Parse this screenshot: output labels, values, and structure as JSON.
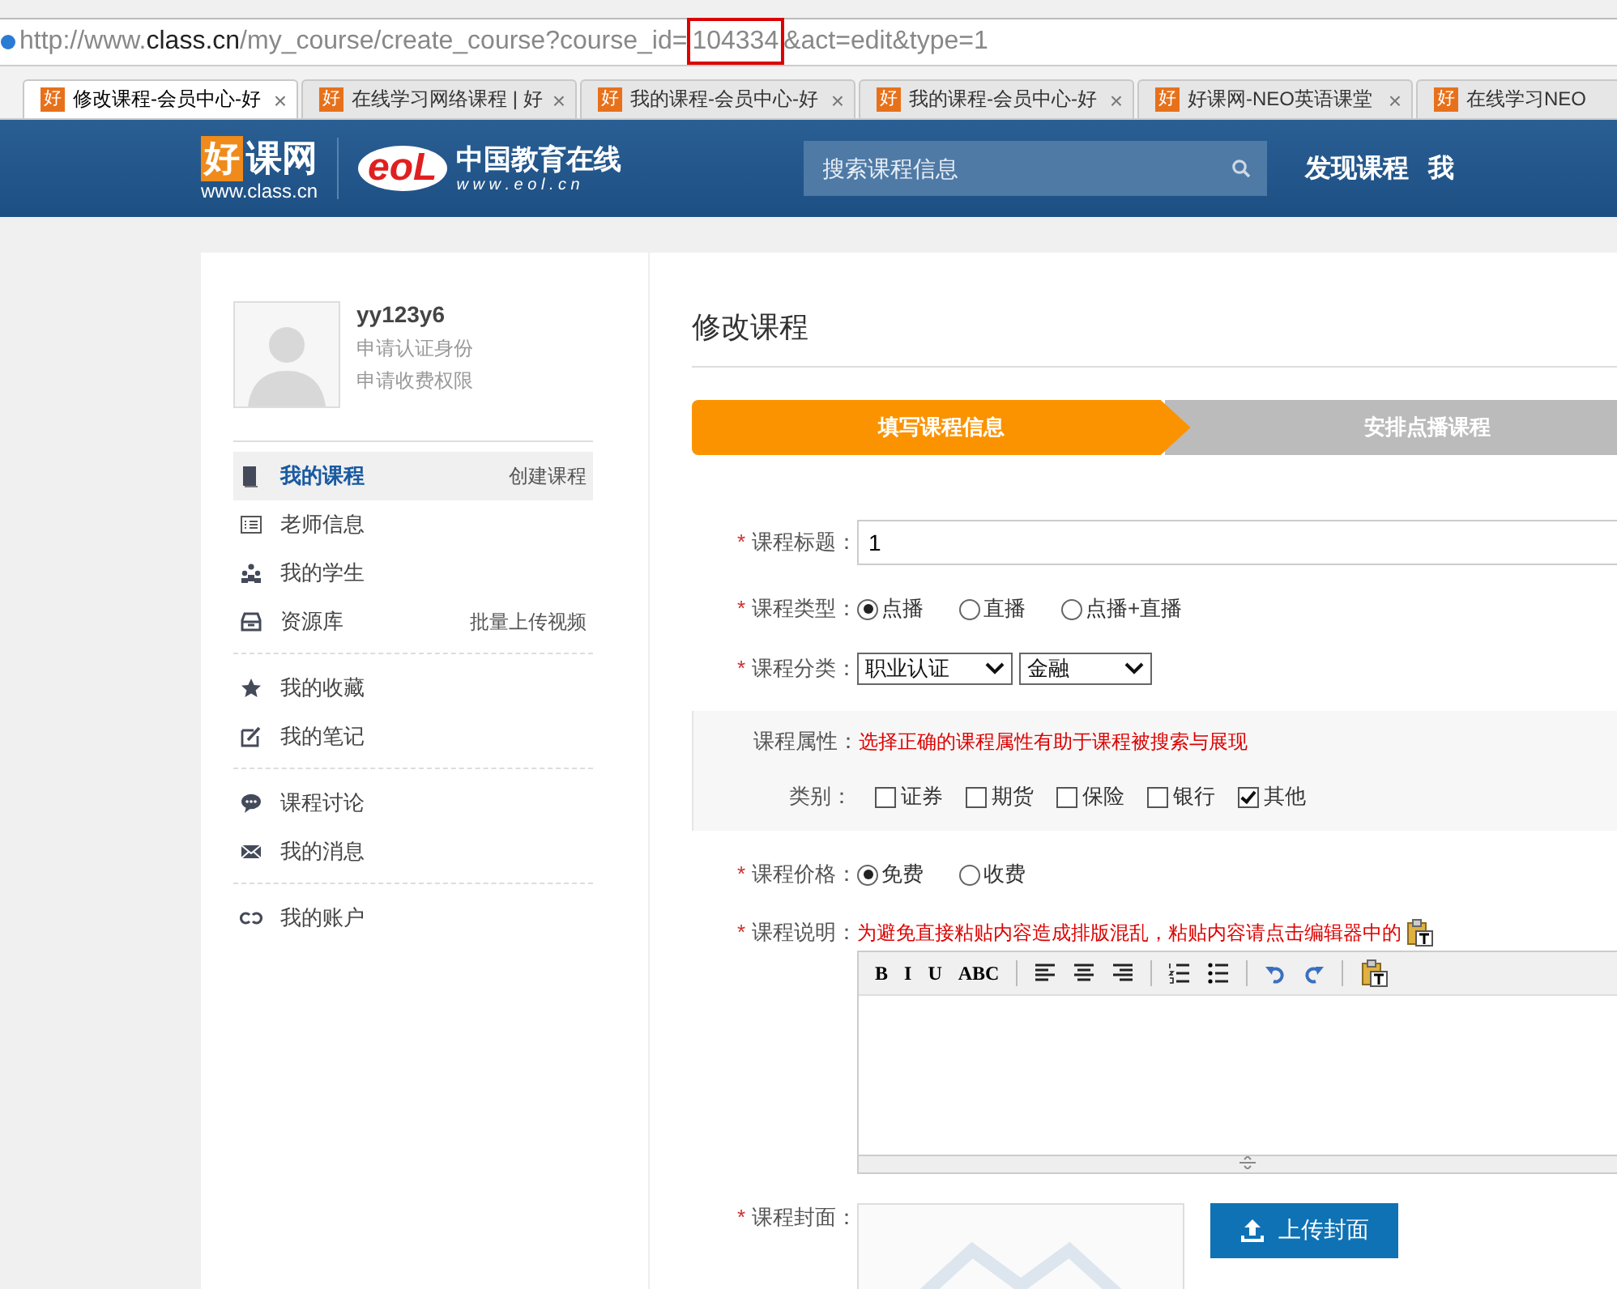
{
  "browser": {
    "url": [
      {
        "text": "http://www.",
        "kind": "muted",
        "highlighted": false
      },
      {
        "text": "class.cn",
        "kind": "host",
        "highlighted": false
      },
      {
        "text": "/my_course/create_course?course_id=",
        "kind": "muted",
        "highlighted": false
      },
      {
        "text": "104334",
        "kind": "muted",
        "highlighted": true
      },
      {
        "text": "&act=edit&type=1",
        "kind": "muted",
        "highlighted": false
      }
    ],
    "tabs": [
      {
        "favicon": "好",
        "label": "修改课程-会员中心-好",
        "selected": true
      },
      {
        "favicon": "好",
        "label": "在线学习网络课程 | 好",
        "selected": false
      },
      {
        "favicon": "好",
        "label": "我的课程-会员中心-好",
        "selected": false
      },
      {
        "favicon": "好",
        "label": "我的课程-会员中心-好",
        "selected": false
      },
      {
        "favicon": "好",
        "label": "好课网-NEO英语课堂",
        "selected": false
      },
      {
        "favicon": "好",
        "label": "在线学习NEO",
        "selected": false
      }
    ],
    "tab_close": "×"
  },
  "header": {
    "logo": {
      "mark": "好",
      "name": "课网",
      "url": "www.class.cn"
    },
    "partner": {
      "mark": "eoL",
      "name": "中国教育在线",
      "url": "w w w . e o l . c n"
    },
    "search": {
      "placeholder": "搜索课程信息"
    },
    "nav": [
      "发现课程",
      "我"
    ]
  },
  "sidebar": {
    "user": {
      "name": "yy123y6",
      "links": [
        "申请认证身份",
        "申请收费权限"
      ]
    },
    "groups": [
      [
        {
          "kind": "book",
          "label": "我的课程",
          "action": "创建课程",
          "selected": true
        },
        {
          "kind": "list",
          "label": "老师信息",
          "selected": false
        },
        {
          "kind": "people",
          "label": "我的学生",
          "selected": false
        },
        {
          "kind": "box",
          "label": "资源库",
          "action": "批量上传视频",
          "selected": false
        }
      ],
      [
        {
          "kind": "star",
          "label": "我的收藏",
          "selected": false
        },
        {
          "kind": "edit",
          "label": "我的笔记",
          "selected": false
        }
      ],
      [
        {
          "kind": "chat",
          "label": "课程讨论",
          "selected": false
        },
        {
          "kind": "mail",
          "label": "我的消息",
          "selected": false
        }
      ],
      [
        {
          "kind": "link",
          "label": "我的账户",
          "selected": false
        }
      ]
    ]
  },
  "form": {
    "title": "修改课程",
    "steps": [
      {
        "label": "填写课程信息",
        "selected": true
      },
      {
        "label": "安排点播课程",
        "selected": false
      }
    ],
    "fields": [
      {
        "kind": "text",
        "required": true,
        "label": "课程标题：",
        "value": "1"
      },
      {
        "kind": "radio",
        "required": true,
        "label": "课程类型：",
        "options": [
          {
            "label": "点播",
            "selected": true
          },
          {
            "label": "直播",
            "selected": false
          },
          {
            "label": "点播+直播",
            "selected": false
          }
        ]
      },
      {
        "kind": "select",
        "required": true,
        "label": "课程分类：",
        "selects": [
          "职业认证",
          "金融"
        ]
      },
      {
        "kind": "attributes",
        "required": false,
        "label": "课程属性：",
        "hint": "选择正确的课程属性有助于课程被搜索与展现",
        "sublabel": "类别：",
        "options": [
          {
            "label": "证券",
            "checked": false
          },
          {
            "label": "期货",
            "checked": false
          },
          {
            "label": "保险",
            "checked": false
          },
          {
            "label": "银行",
            "checked": false
          },
          {
            "label": "其他",
            "checked": true
          }
        ]
      },
      {
        "kind": "radio",
        "required": true,
        "label": "课程价格：",
        "options": [
          {
            "label": "免费",
            "selected": true
          },
          {
            "label": "收费",
            "selected": false
          }
        ]
      },
      {
        "kind": "editor",
        "required": true,
        "label": "课程说明：",
        "hint": "为避免直接粘贴内容造成排版混乱，粘贴内容请点击编辑器中的",
        "tools": [
          {
            "kind": "text",
            "text": "B"
          },
          {
            "kind": "text",
            "text": "I"
          },
          {
            "kind": "text",
            "text": "U"
          },
          {
            "kind": "text",
            "text": "ABC"
          },
          {
            "kind": "sep"
          },
          {
            "kind": "align-left"
          },
          {
            "kind": "align-center"
          },
          {
            "kind": "align-right"
          },
          {
            "kind": "sep"
          },
          {
            "kind": "numbered-list"
          },
          {
            "kind": "bullet-list"
          },
          {
            "kind": "sep"
          },
          {
            "kind": "undo"
          },
          {
            "kind": "redo"
          },
          {
            "kind": "sep"
          },
          {
            "kind": "paste"
          }
        ]
      },
      {
        "kind": "cover",
        "required": true,
        "label": "课程封面：",
        "button": "上传封面"
      }
    ],
    "required_mark": "*"
  }
}
